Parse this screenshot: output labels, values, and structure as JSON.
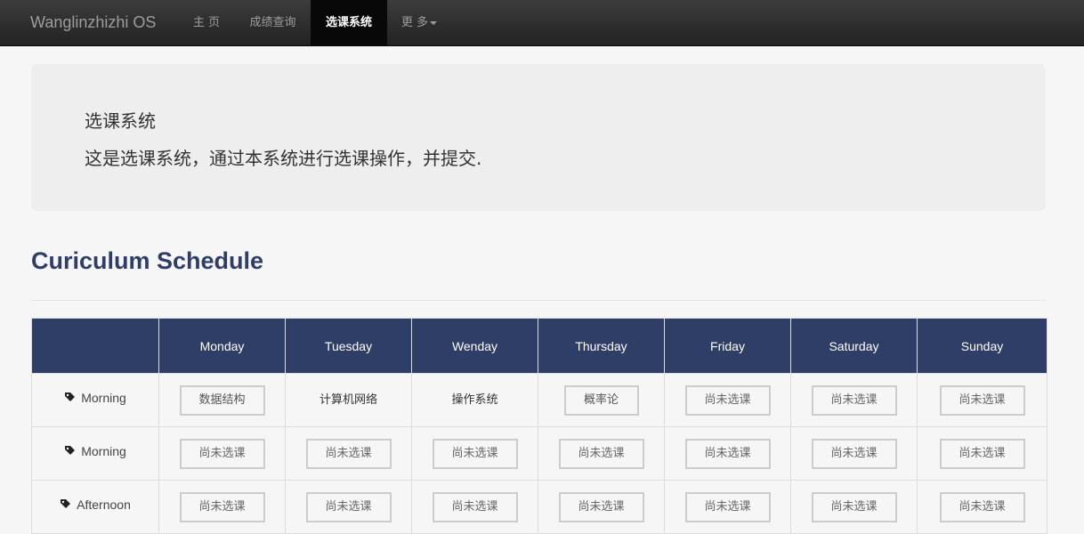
{
  "navbar": {
    "brand": "Wanglinzhizhi OS",
    "items": [
      {
        "label": "主 页"
      },
      {
        "label": "成绩查询"
      },
      {
        "label": "选课系统"
      },
      {
        "label": "更 多"
      }
    ],
    "active_index": 2
  },
  "jumbotron": {
    "title": "选课系统",
    "text": "这是选课系统，通过本系统进行选课操作，并提交."
  },
  "page_header": "Curiculum Schedule",
  "schedule": {
    "headers": [
      "",
      "Monday",
      "Tuesday",
      "Wenday",
      "Thursday",
      "Friday",
      "Saturday",
      "Sunday"
    ],
    "rows": [
      {
        "slot": "Morning",
        "cells": [
          {
            "text": "数据结构",
            "kind": "button"
          },
          {
            "text": "计算机网络",
            "kind": "plain"
          },
          {
            "text": "操作系统",
            "kind": "plain"
          },
          {
            "text": "概率论",
            "kind": "button"
          },
          {
            "text": "尚未选课",
            "kind": "button"
          },
          {
            "text": "尚未选课",
            "kind": "button"
          },
          {
            "text": "尚未选课",
            "kind": "button"
          }
        ]
      },
      {
        "slot": "Morning",
        "cells": [
          {
            "text": "尚未选课",
            "kind": "button"
          },
          {
            "text": "尚未选课",
            "kind": "button"
          },
          {
            "text": "尚未选课",
            "kind": "button"
          },
          {
            "text": "尚未选课",
            "kind": "button"
          },
          {
            "text": "尚未选课",
            "kind": "button"
          },
          {
            "text": "尚未选课",
            "kind": "button"
          },
          {
            "text": "尚未选课",
            "kind": "button"
          }
        ]
      },
      {
        "slot": "Afternoon",
        "cells": [
          {
            "text": "尚未选课",
            "kind": "button"
          },
          {
            "text": "尚未选课",
            "kind": "button"
          },
          {
            "text": "尚未选课",
            "kind": "button"
          },
          {
            "text": "尚未选课",
            "kind": "button"
          },
          {
            "text": "尚未选课",
            "kind": "button"
          },
          {
            "text": "尚未选课",
            "kind": "button"
          },
          {
            "text": "尚未选课",
            "kind": "button"
          }
        ]
      }
    ]
  },
  "colors": {
    "navbar_bg": "#222222",
    "header_accent": "#2e3e66",
    "jumbotron_bg": "#eeeeee"
  },
  "icons": {
    "slot_icon": "tag-icon",
    "dropdown_icon": "caret-down-icon"
  }
}
